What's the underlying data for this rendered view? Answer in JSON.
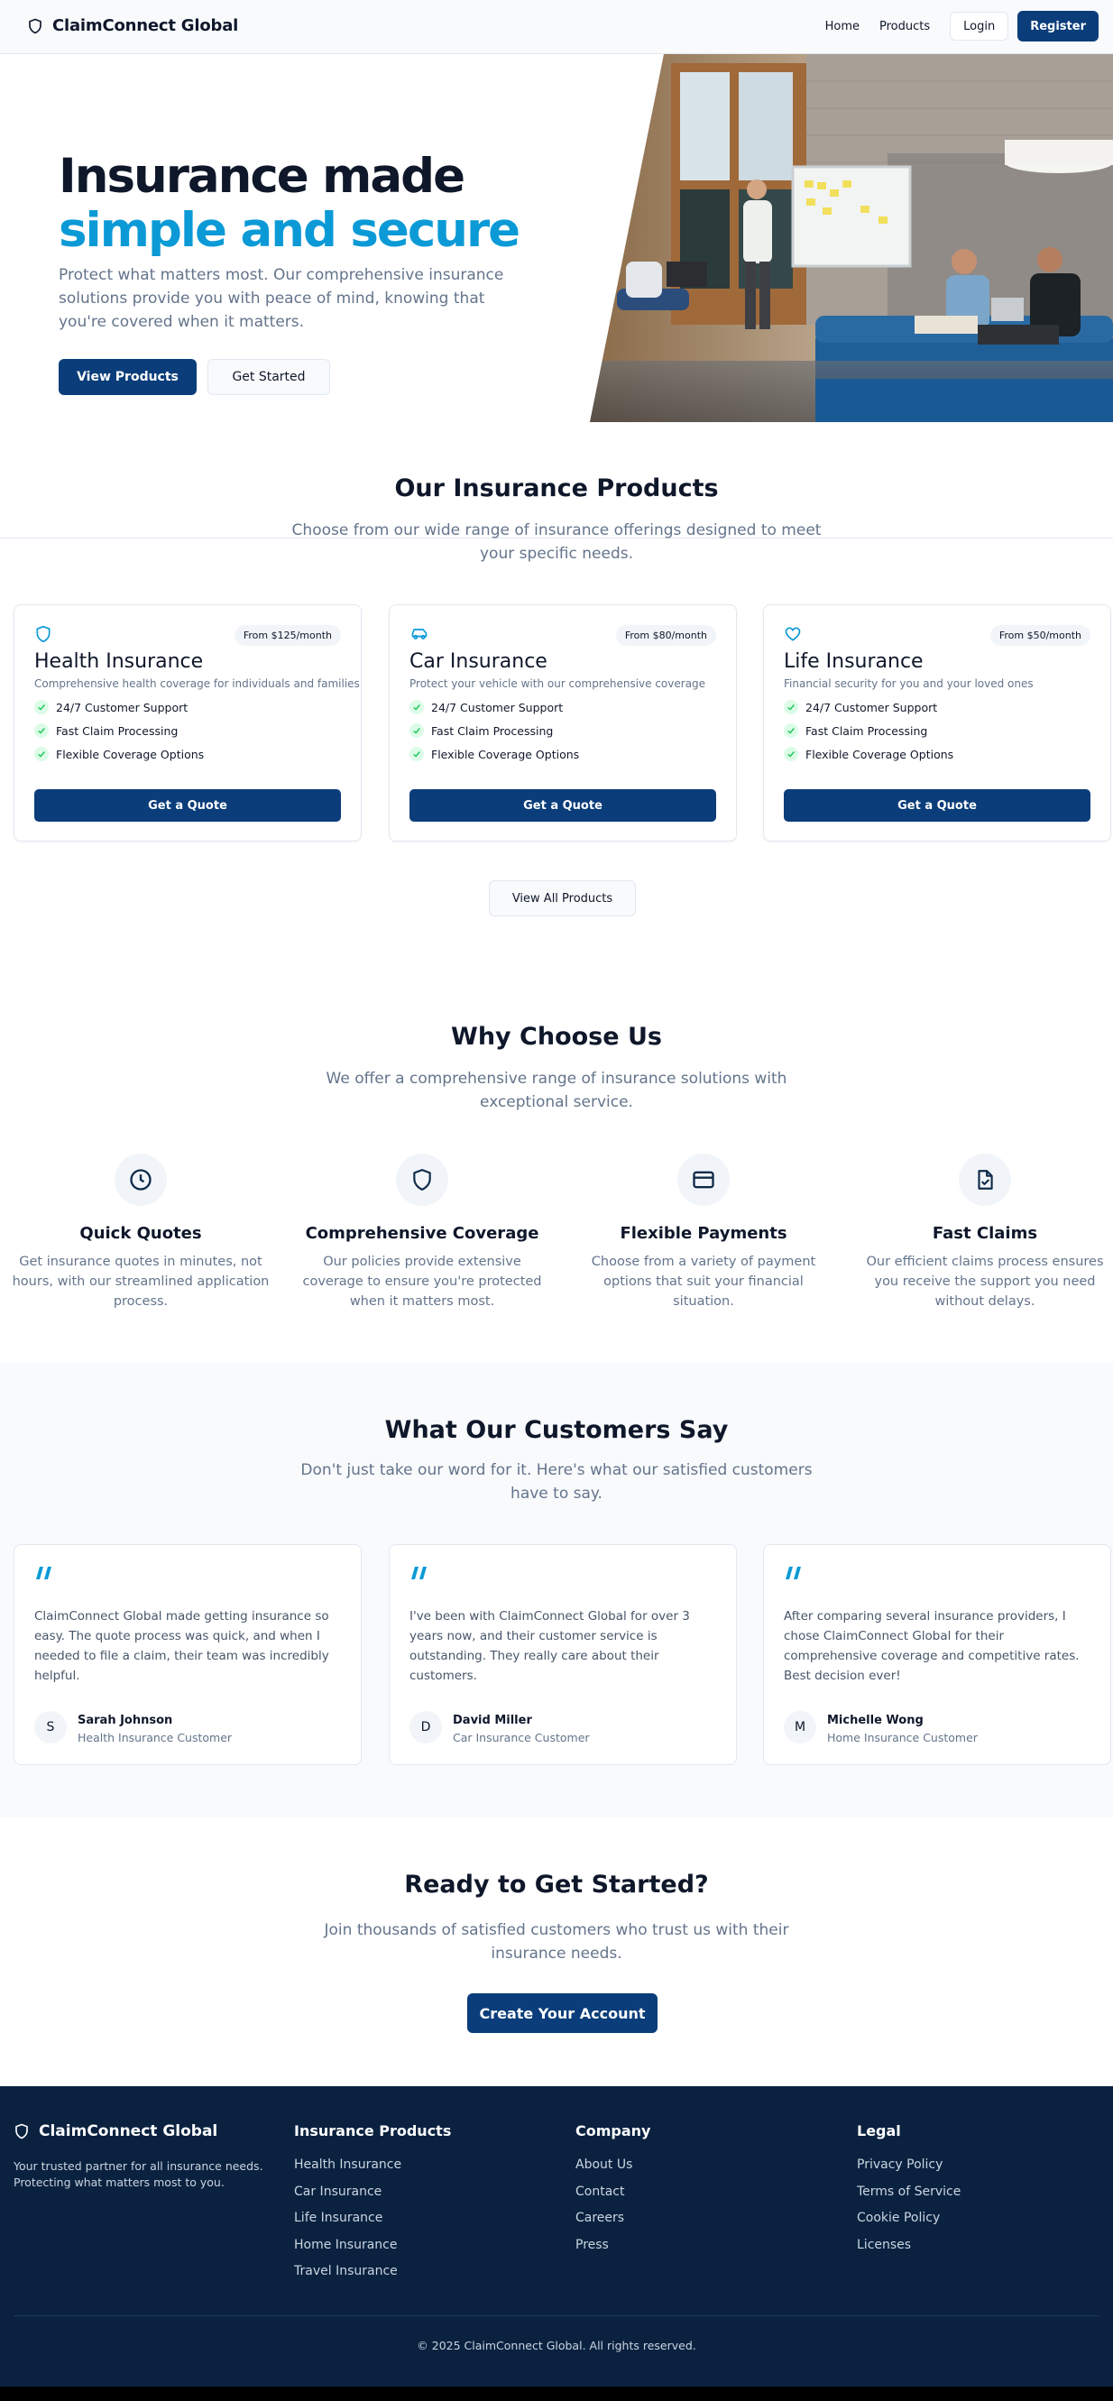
{
  "brand": {
    "name": "ClaimConnect Global",
    "logo_icon": "shield-icon"
  },
  "nav": {
    "home": "Home",
    "products": "Products",
    "login": "Login",
    "register": "Register"
  },
  "hero": {
    "title_line1": "Insurance made",
    "title_line2": "simple and secure",
    "subtitle": "Protect what matters most. Our comprehensive insurance solutions provide you with peace of mind, knowing that you're covered when it matters.",
    "primary_button": "View Products",
    "secondary_button": "Get Started"
  },
  "products": {
    "title": "Our Insurance Products",
    "subtitle": "Choose from our wide range of insurance offerings designed to meet your specific needs.",
    "items": [
      {
        "icon": "shield-icon",
        "price": "From $125/month",
        "title": "Health Insurance",
        "desc": "Comprehensive health coverage for individuals and families",
        "features": [
          "24/7 Customer Support",
          "Fast Claim Processing",
          "Flexible Coverage Options"
        ],
        "button": "Get a Quote"
      },
      {
        "icon": "car-icon",
        "price": "From $80/month",
        "title": "Car Insurance",
        "desc": "Protect your vehicle with our comprehensive coverage",
        "features": [
          "24/7 Customer Support",
          "Fast Claim Processing",
          "Flexible Coverage Options"
        ],
        "button": "Get a Quote"
      },
      {
        "icon": "heart-icon",
        "price": "From $50/month",
        "title": "Life Insurance",
        "desc": "Financial security for you and your loved ones",
        "features": [
          "24/7 Customer Support",
          "Fast Claim Processing",
          "Flexible Coverage Options"
        ],
        "button": "Get a Quote"
      }
    ],
    "view_all": "View All Products"
  },
  "why": {
    "title": "Why Choose Us",
    "subtitle": "We offer a comprehensive range of insurance solutions with exceptional service.",
    "items": [
      {
        "icon": "clock-icon",
        "title": "Quick Quotes",
        "desc": "Get insurance quotes in minutes, not hours, with our streamlined application process."
      },
      {
        "icon": "shield-icon",
        "title": "Comprehensive Coverage",
        "desc": "Our policies provide extensive coverage to ensure you're protected when it matters most."
      },
      {
        "icon": "credit-card-icon",
        "title": "Flexible Payments",
        "desc": "Choose from a variety of payment options that suit your financial situation."
      },
      {
        "icon": "file-check-icon",
        "title": "Fast Claims",
        "desc": "Our efficient claims process ensures you receive the support you need without delays."
      }
    ]
  },
  "testimonials": {
    "title": "What Our Customers Say",
    "subtitle": "Don't just take our word for it. Here's what our satisfied customers have to say.",
    "items": [
      {
        "text": "ClaimConnect Global made getting insurance so easy. The quote process was quick, and when I needed to file a claim, their team was incredibly helpful.",
        "initial": "S",
        "name": "Sarah Johnson",
        "role": "Health Insurance Customer"
      },
      {
        "text": "I've been with ClaimConnect Global for over 3 years now, and their customer service is outstanding. They really care about their customers.",
        "initial": "D",
        "name": "David Miller",
        "role": "Car Insurance Customer"
      },
      {
        "text": "After comparing several insurance providers, I chose ClaimConnect Global for their comprehensive coverage and competitive rates. Best decision ever!",
        "initial": "M",
        "name": "Michelle Wong",
        "role": "Home Insurance Customer"
      }
    ]
  },
  "cta": {
    "title": "Ready to Get Started?",
    "subtitle": "Join thousands of satisfied customers who trust us with their insurance needs.",
    "button": "Create Your Account"
  },
  "footer": {
    "brand": "ClaimConnect Global",
    "tagline": "Your trusted partner for all insurance needs. Protecting what matters most to you.",
    "columns": [
      {
        "title": "Insurance Products",
        "links": [
          "Health Insurance",
          "Car Insurance",
          "Life Insurance",
          "Home Insurance",
          "Travel Insurance"
        ]
      },
      {
        "title": "Company",
        "links": [
          "About Us",
          "Contact",
          "Careers",
          "Press"
        ]
      },
      {
        "title": "Legal",
        "links": [
          "Privacy Policy",
          "Terms of Service",
          "Cookie Policy",
          "Licenses"
        ]
      }
    ],
    "copyright": "© 2025 ClaimConnect Global. All rights reserved."
  },
  "colors": {
    "primary": "#0a3d7a",
    "accent": "#0b9ad6",
    "footer_bg": "#0a2240",
    "check_green": "#22c55e"
  }
}
